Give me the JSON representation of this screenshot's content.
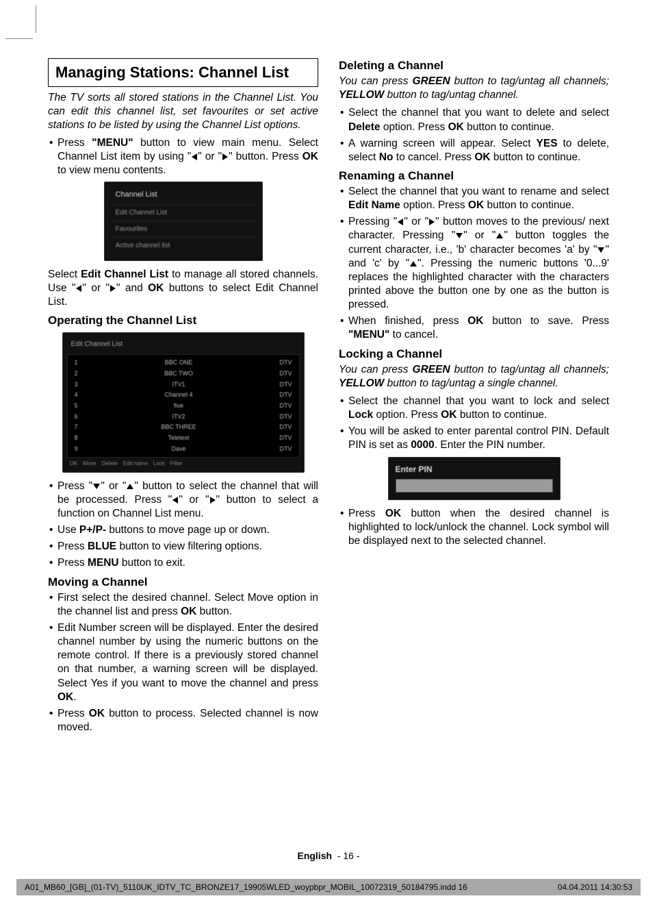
{
  "title": "Managing Stations: Channel List",
  "intro1": "The TV sorts all stored stations in the Channel List. You can edit this channel list, set favourites or set active stations to be listed by using the Channel List options.",
  "bullet1": "Press \"MENU\" button to view main menu. Select Channel List item by using \"◀\" or \"▶\" button. Press OK to view menu contents.",
  "menu1": {
    "title": "Channel List",
    "items": [
      "Edit Channel List",
      "Favourites",
      "Active channel list"
    ]
  },
  "after_menu1_a": "Select Edit Channel List to manage all stored channels. Use \"◀\" or \"▶\"  and OK buttons to select Edit Channel List.",
  "sub_operating": "Operating the Channel List",
  "channel_table": {
    "header": "Edit Channel List",
    "rows": [
      {
        "n": "1",
        "name": "BBC ONE",
        "t": "DTV"
      },
      {
        "n": "2",
        "name": "BBC TWO",
        "t": "DTV"
      },
      {
        "n": "3",
        "name": "ITV1",
        "t": "DTV"
      },
      {
        "n": "4",
        "name": "Channel 4",
        "t": "DTV"
      },
      {
        "n": "5",
        "name": "five",
        "t": "DTV"
      },
      {
        "n": "6",
        "name": "ITV2",
        "t": "DTV"
      },
      {
        "n": "7",
        "name": "BBC THREE",
        "t": "DTV"
      },
      {
        "n": "8",
        "name": "Teletext",
        "t": "DTV"
      },
      {
        "n": "9",
        "name": "Dave",
        "t": "DTV"
      }
    ],
    "footer": [
      "OK",
      "Move",
      "Delete",
      "Edit name",
      "Lock",
      "Filter"
    ]
  },
  "col1_bullets2": [
    "Press \"▼\" or \"▲\" button to select the channel that will be processed. Press \"◀\" or \"▶\" button to select a function on Channel List menu.",
    "Use P+/P- buttons to move page up or down.",
    "Press BLUE button to view filtering options.",
    "Press MENU button to exit."
  ],
  "sub_moving": "Moving a Channel",
  "moving_bullets": [
    "First select the desired channel. Select Move option in the channel list and press OK button.",
    "Edit Number screen will be displayed. Enter the desired channel number by using the numeric buttons on the remote control. If there is a previously stored channel on that number, a warning screen will be displayed. Select Yes if you want to move the channel and press OK.",
    "Press OK button to process. Selected channel is now moved."
  ],
  "sub_deleting": "Deleting a Channel",
  "deleting_intro": "You can press GREEN button to tag/untag all channels; YELLOW button to tag/untag channel.",
  "deleting_bullets": [
    "Select the channel that you want to delete and select Delete option. Press OK button to continue.",
    "A warning screen will appear. Select YES to delete, select No to cancel. Press OK button to continue."
  ],
  "sub_renaming": "Renaming a Channel",
  "renaming_bullets": [
    "Select the channel that you want to rename and select Edit Name option. Press OK button to continue.",
    "Pressing \"◀\" or \"▶\" button moves to the previous/ next character. Pressing \"▼\" or \"▲\" button toggles the current character, i.e., 'b' character becomes 'a' by \"▼\" and 'c' by \"▲\". Pressing the numeric buttons '0...9' replaces the highlighted character with the characters printed above the button one by one as the button is pressed.",
    "When finished, press OK button to save. Press \"MENU\" to cancel."
  ],
  "sub_locking": "Locking a Channel",
  "locking_intro": "You can press GREEN button to tag/untag all channels; YELLOW button to tag/untag a single channel.",
  "locking_bullets": [
    "Select the channel that you want to lock and select Lock option. Press OK button to continue.",
    "You will be asked to enter parental control PIN. Default PIN is set as 0000. Enter the PIN number."
  ],
  "pin_label": "Enter PIN",
  "locking_after": [
    "Press OK button when the desired channel is highlighted to lock/unlock the channel. Lock symbol will be displayed next to the selected channel."
  ],
  "footer_lang": "English",
  "footer_page": "- 16 -",
  "indd": {
    "file": "A01_MB60_[GB]_(01-TV)_5110UK_IDTV_TC_BRONZE17_19905WLED_woypbpr_MOBIL_10072319_50184795.indd   16",
    "time": "04.04.2011   14:30:53"
  }
}
